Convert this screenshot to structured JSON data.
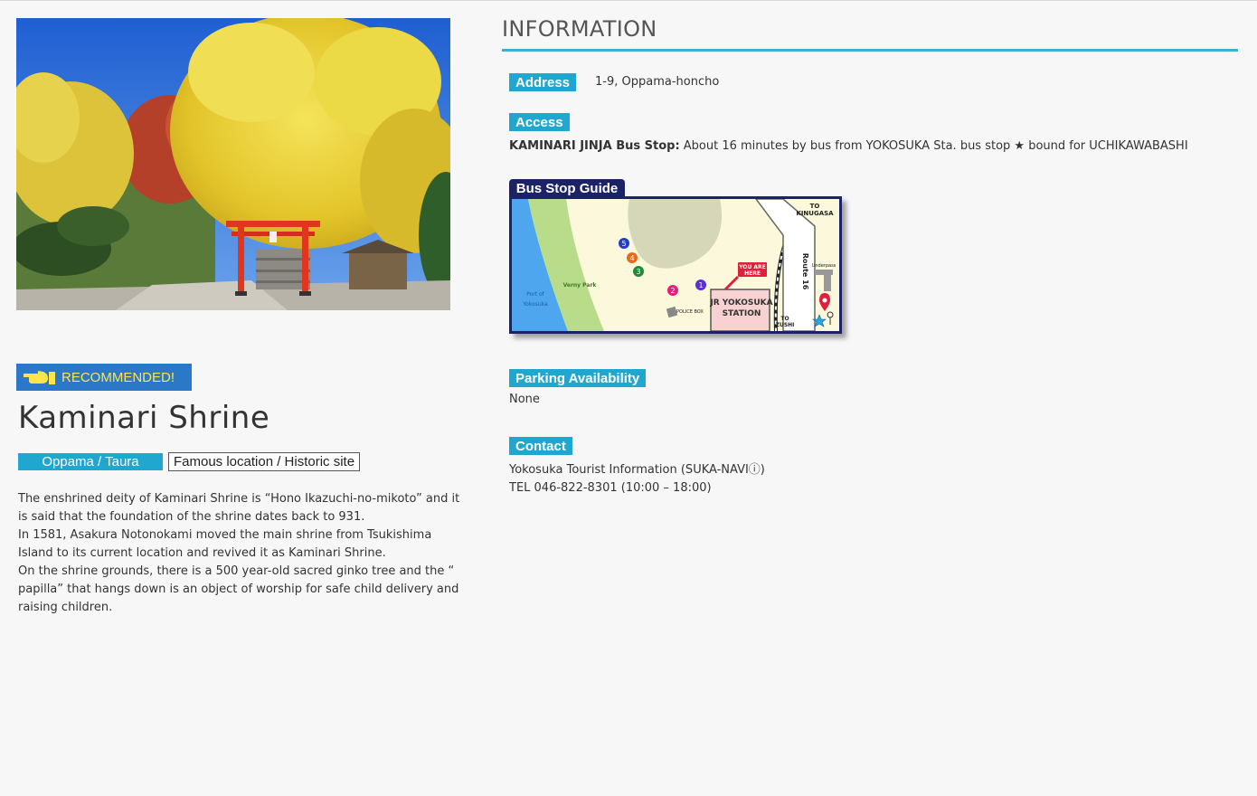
{
  "left": {
    "recommended_label": "RECOMMENDED!",
    "title": "Kaminari Shrine",
    "area_tag": "Oppama / Taura",
    "category_tag": "Famous location / Historic site",
    "description": [
      "The enshrined deity of Kaminari Shrine is “Hono Ikazuchi-no-mikoto” and it is said that the foundation of the shrine dates back to 931.",
      "In 1581, Asakura Notonokami moved the main shrine from Tsukishima Island to its current location and revived it as Kaminari Shrine.",
      "On the shrine grounds, there is a 500 year-old sacred ginko tree and the “ papilla” that hangs down is an object of worship for safe child delivery and raising children."
    ]
  },
  "info": {
    "heading": "INFORMATION",
    "address": {
      "label": "Address",
      "value": "1-9, Oppama-honcho"
    },
    "access": {
      "label": "Access",
      "stop": "KAMINARI JINJA Bus Stop:",
      "detail": "About 16 minutes by bus from YOKOSUKA Sta. bus stop ★ bound for UCHIKAWABASHI"
    },
    "bus_stop_guide": {
      "label": "Bus Stop Guide",
      "map_labels": {
        "to_kinugasa_1": "TO",
        "to_kinugasa_2": "KINUGASA",
        "route": "Route 16",
        "underpass": "Underpass",
        "you_are_here_1": "YOU ARE",
        "you_are_here_2": "HERE",
        "station_1": "JR YOKOSUKA",
        "station_2": "STATION",
        "to_zushi_1": "TO",
        "to_zushi_2": "ZUSHI",
        "police_box": "POLICE BOX",
        "verny_park": "Verny Park",
        "port_1": "Port of",
        "port_2": "Yokosuka",
        "stop_1": "1",
        "stop_2": "2",
        "stop_3": "3",
        "stop_4": "4",
        "stop_5": "5"
      }
    },
    "parking": {
      "label": "Parking Availability",
      "value": "None"
    },
    "contact": {
      "label": "Contact",
      "line1": "Yokosuka Tourist Information (SUKA-NAVIⓘ)",
      "line2": "TEL 046-822-8301 (10:00 – 18:00)"
    }
  },
  "colors": {
    "accent": "#20a7cf",
    "recommended_bg": "#2a78c7",
    "recommended_text": "#ffe44c",
    "map_frame": "#1c2266"
  }
}
